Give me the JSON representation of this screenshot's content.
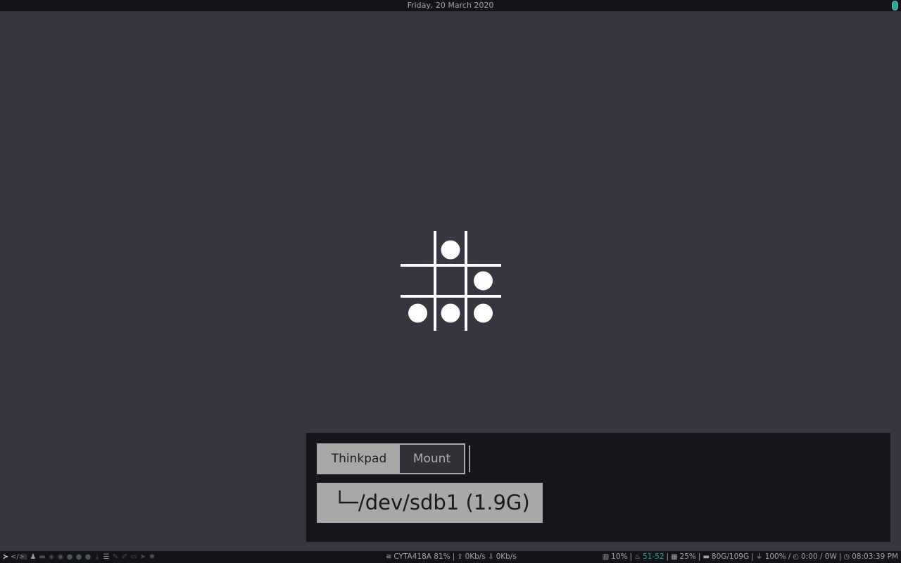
{
  "topbar": {
    "date": "Friday, 20 March 2020"
  },
  "workspaces": [
    {
      "icon": "terminal-icon",
      "glyph": "≻",
      "state": "active"
    },
    {
      "icon": "code-icon",
      "glyph": "</>",
      "state": "occupied"
    },
    {
      "icon": "document-icon",
      "glyph": "▤",
      "state": "empty"
    },
    {
      "icon": "user-secret-icon",
      "glyph": "♟",
      "state": "occupied"
    },
    {
      "icon": "folder-icon",
      "glyph": "▬",
      "state": "empty"
    },
    {
      "icon": "cube-icon",
      "glyph": "◈",
      "state": "empty"
    },
    {
      "icon": "database-icon",
      "glyph": "◉",
      "state": "empty"
    },
    {
      "icon": "circle-icon",
      "glyph": "●",
      "state": "empty"
    },
    {
      "icon": "circle-icon",
      "glyph": "●",
      "state": "empty"
    },
    {
      "icon": "circle-icon",
      "glyph": "●",
      "state": "empty"
    },
    {
      "icon": "download-icon",
      "glyph": "⤓",
      "state": "empty"
    },
    {
      "icon": "sliders-icon",
      "glyph": "☰",
      "state": "occupied"
    },
    {
      "icon": "pen-icon",
      "glyph": "✎",
      "state": "empty"
    },
    {
      "icon": "edit-icon",
      "glyph": "✐",
      "state": "empty"
    },
    {
      "icon": "inbox-icon",
      "glyph": "▭",
      "state": "empty"
    },
    {
      "icon": "send-icon",
      "glyph": "➤",
      "state": "empty"
    },
    {
      "icon": "settings-icon",
      "glyph": "✱",
      "state": "empty"
    }
  ],
  "menu": {
    "tabs": [
      {
        "label": "Thinkpad",
        "active": true
      },
      {
        "label": "Mount",
        "active": false
      }
    ],
    "entry": "└─/dev/sdb1 (1.9G)"
  },
  "status": {
    "wifi": "CYTA418A 81%",
    "upload": "0Kb/s",
    "download": "0Kb/s",
    "cpu": "10%",
    "temp": "51-52",
    "memory": "25%",
    "disk": "80G/109G",
    "battery": "100%",
    "power": "0:00 / 0W",
    "clock": "08:03:39 PM"
  },
  "colors": {
    "accent": "#2aa1a1",
    "background": "#363640",
    "bar": "#121419"
  }
}
